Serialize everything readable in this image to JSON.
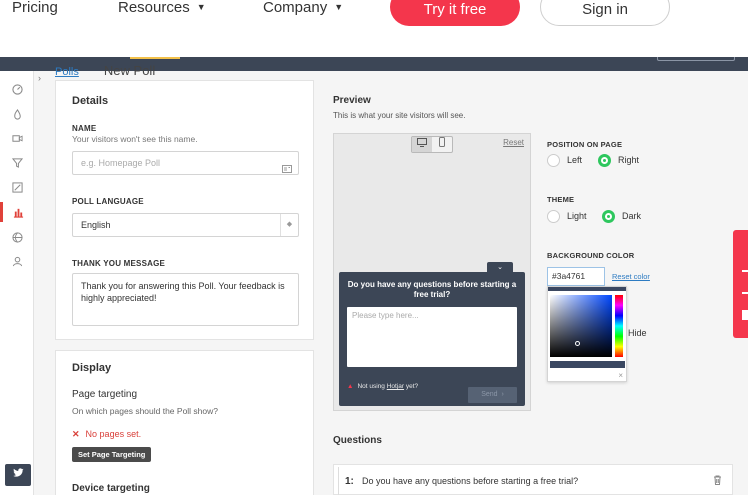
{
  "nav": {
    "pricing": "Pricing",
    "resources": "Resources",
    "company": "Company",
    "try_free": "Try it free",
    "sign_in": "Sign in",
    "caret": "▼"
  },
  "breadcrumb": {
    "link": "Polls",
    "title": "New Poll"
  },
  "sidebar": {
    "icons": [
      "dashboard-icon",
      "heatmap-icon",
      "recordings-icon",
      "funnel-icon",
      "forms-icon",
      "polls-icon",
      "surveys-icon",
      "recruiters-icon"
    ],
    "active_index": 5,
    "expand": "›",
    "twitter_glyph": "🐦"
  },
  "details": {
    "title": "Details",
    "name_label": "NAME",
    "name_help": "Your visitors won't see this name.",
    "name_placeholder": "e.g. Homepage Poll",
    "language_label": "POLL LANGUAGE",
    "language_value": "English",
    "thanks_label": "THANK YOU MESSAGE",
    "thanks_value": "Thank you for answering this Poll. Your feedback is highly appreciated!"
  },
  "display": {
    "title": "Display",
    "page_targeting": "Page targeting",
    "page_targeting_help": "On which pages should the Poll show?",
    "no_pages": "No pages set.",
    "set_targeting_btn": "Set Page Targeting",
    "device_targeting": "Device targeting"
  },
  "preview": {
    "title": "Preview",
    "help": "This is what your site visitors will see.",
    "reset": "Reset",
    "desktop_glyph": "🖵",
    "mobile_glyph": "▯",
    "question": "Do you have any questions before starting a free trial?",
    "textarea_placeholder": "Please type here...",
    "footer_prefix": "Not using",
    "footer_link": "Hotjar",
    "footer_suffix": "yet?",
    "send": "Send",
    "send_arrow": "›",
    "collapse_glyph": "⌄"
  },
  "options": {
    "position_heading": "POSITION ON PAGE",
    "position_left": "Left",
    "position_right": "Right",
    "position_selected": "right",
    "theme_heading": "THEME",
    "theme_light": "Light",
    "theme_dark": "Dark",
    "theme_selected": "dark",
    "bg_heading": "BACKGROUND COLOR",
    "bg_value": "#3a4761",
    "reset_color": "Reset color",
    "hide_partial": "Hide",
    "picker_close": "×"
  },
  "colors": {
    "brand": "#f4364c",
    "header_dark": "#3c4656",
    "radio_green": "#2ec75e",
    "widget_bg": "#3a4761",
    "error_red": "#d9403a"
  },
  "questions": {
    "title": "Questions",
    "items": [
      {
        "number": "1:",
        "text": "Do you have any questions before starting a free trial?"
      }
    ]
  }
}
